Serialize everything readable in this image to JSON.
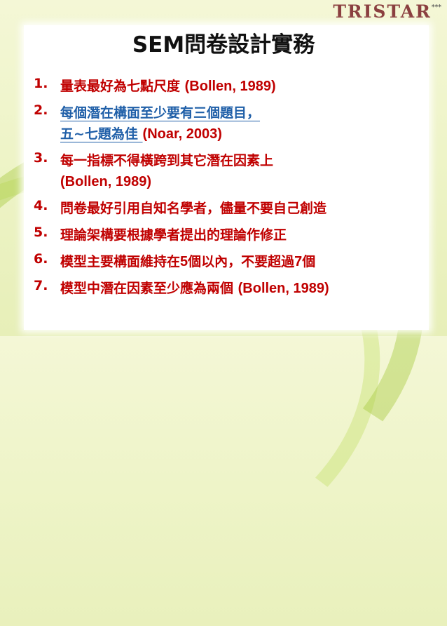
{
  "brand": {
    "name": "TRISTAR",
    "stars": "***"
  },
  "title": "SEM問卷設計實務",
  "items": [
    {
      "num": "1.",
      "l1_text": "量表最好為七點尺度 ",
      "l1_ref": "(Bollen, 1989)"
    },
    {
      "num": "2.",
      "l1_link": "每個潛在構面至少要有三個題目，",
      "l2_link": "五~七題為佳 ",
      "l2_ref": "(Noar, 2003)"
    },
    {
      "num": "3.",
      "l1_text": "每一指標不得橫跨到其它潛在因素上",
      "l2_ref": "(Bollen, 1989)"
    },
    {
      "num": "4.",
      "l1_text": "問卷最好引用自知名學者，儘量不要自己創造"
    },
    {
      "num": "5.",
      "l1_text": "理論架構要根據學者提出的理論作修正"
    },
    {
      "num": "6.",
      "l1_a": "模型主要構面維持在",
      "l1_n1": "5",
      "l1_b": "個以內，不要超過",
      "l1_n2": "7",
      "l1_c": "個"
    },
    {
      "num": "7.",
      "l1_text": "模型中潛在因素至少應為兩個 ",
      "l1_ref": "(Bollen, 1989)"
    }
  ],
  "colors": {
    "accent": "#c00000",
    "link": "#1f5fa8",
    "background": "#eef4c8",
    "brand": "#8a3f3f"
  }
}
